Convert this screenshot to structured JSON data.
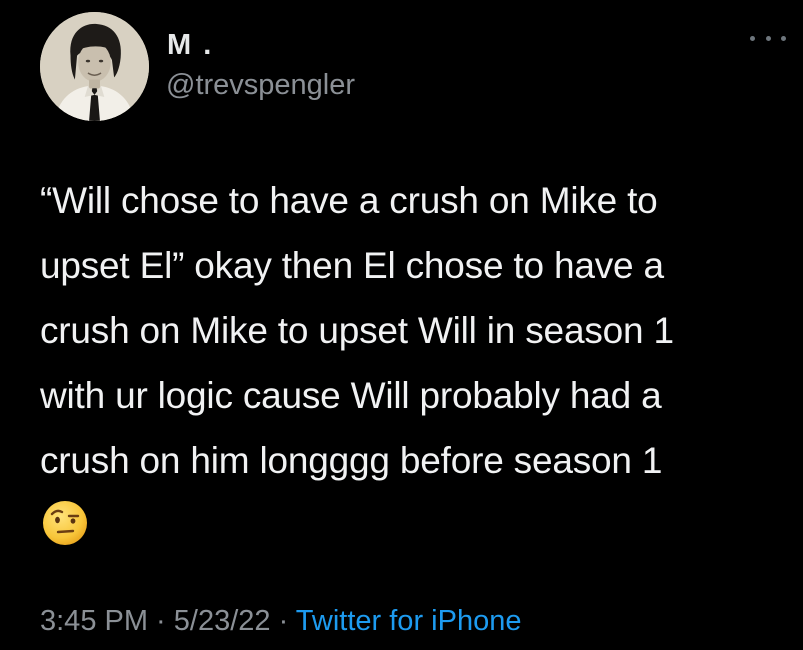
{
  "user": {
    "display_name": "M .",
    "handle": "@trevspengler",
    "avatar_icon": "profile-photo"
  },
  "menu_icon": "more-horizontal-icon",
  "tweet": {
    "text": "“Will chose to have a crush on Mike to\nupset El” okay then El chose to have a\ncrush on Mike to upset Will in season 1\nwith ur logic cause Will probably had a\ncrush on him longggg before season 1",
    "emoji": "face-with-raised-eyebrow"
  },
  "meta": {
    "time": "3:45 PM",
    "sep1": " · ",
    "date": "5/23/22",
    "sep2": " · ",
    "source": "Twitter for iPhone"
  },
  "colors": {
    "background": "#000000",
    "text": "#e7e9ea",
    "secondary": "#8b9096",
    "link": "#1d9bf0"
  }
}
